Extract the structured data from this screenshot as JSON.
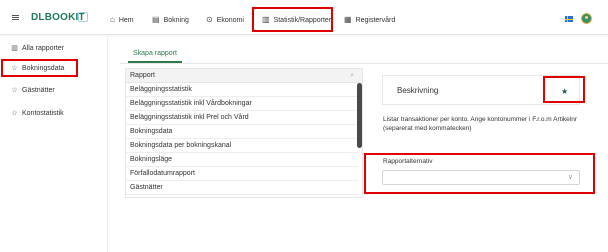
{
  "topbar": {
    "logo_text": "DLBOOKIT",
    "nav": [
      {
        "label": "Hem",
        "icon": "home-icon"
      },
      {
        "label": "Bokning",
        "icon": "calendar-icon"
      },
      {
        "label": "Ekonomi",
        "icon": "coin-icon"
      },
      {
        "label": "Statistik/Rapporter",
        "icon": "chart-icon"
      },
      {
        "label": "Registervård",
        "icon": "grid-icon"
      }
    ]
  },
  "sidebar": {
    "items": [
      {
        "label": "Alla rapporter",
        "icon": "chart-icon"
      },
      {
        "label": "Bokningsdata",
        "icon": "star-icon"
      },
      {
        "label": "Gästnätter",
        "icon": "star-icon"
      },
      {
        "label": "Kontostatistik",
        "icon": "star-icon"
      }
    ]
  },
  "tabs": {
    "create_report": "Skapa rapport"
  },
  "report_list": {
    "header": "Rapport",
    "rows": [
      "Beläggningsstatistik",
      "Beläggningsstatistik inkl Vårdbokningar",
      "Beläggningsstatistik inkl Prel och Vård",
      "Bokningsdata",
      "Bokningsdata per bokningskanal",
      "Bokningsläge",
      "Förfallodatumrapport",
      "Gästnätter"
    ]
  },
  "description": {
    "title": "Beskrivning",
    "text": "Listar transaktioner per konto. Ange kontonummer i F.r.o.m Artikelnr (separerat med kommatecken)"
  },
  "options": {
    "label": "Rapportalternativ",
    "selected": ""
  },
  "colors": {
    "brand": "#1f7a5a",
    "highlight": "#e00000"
  }
}
